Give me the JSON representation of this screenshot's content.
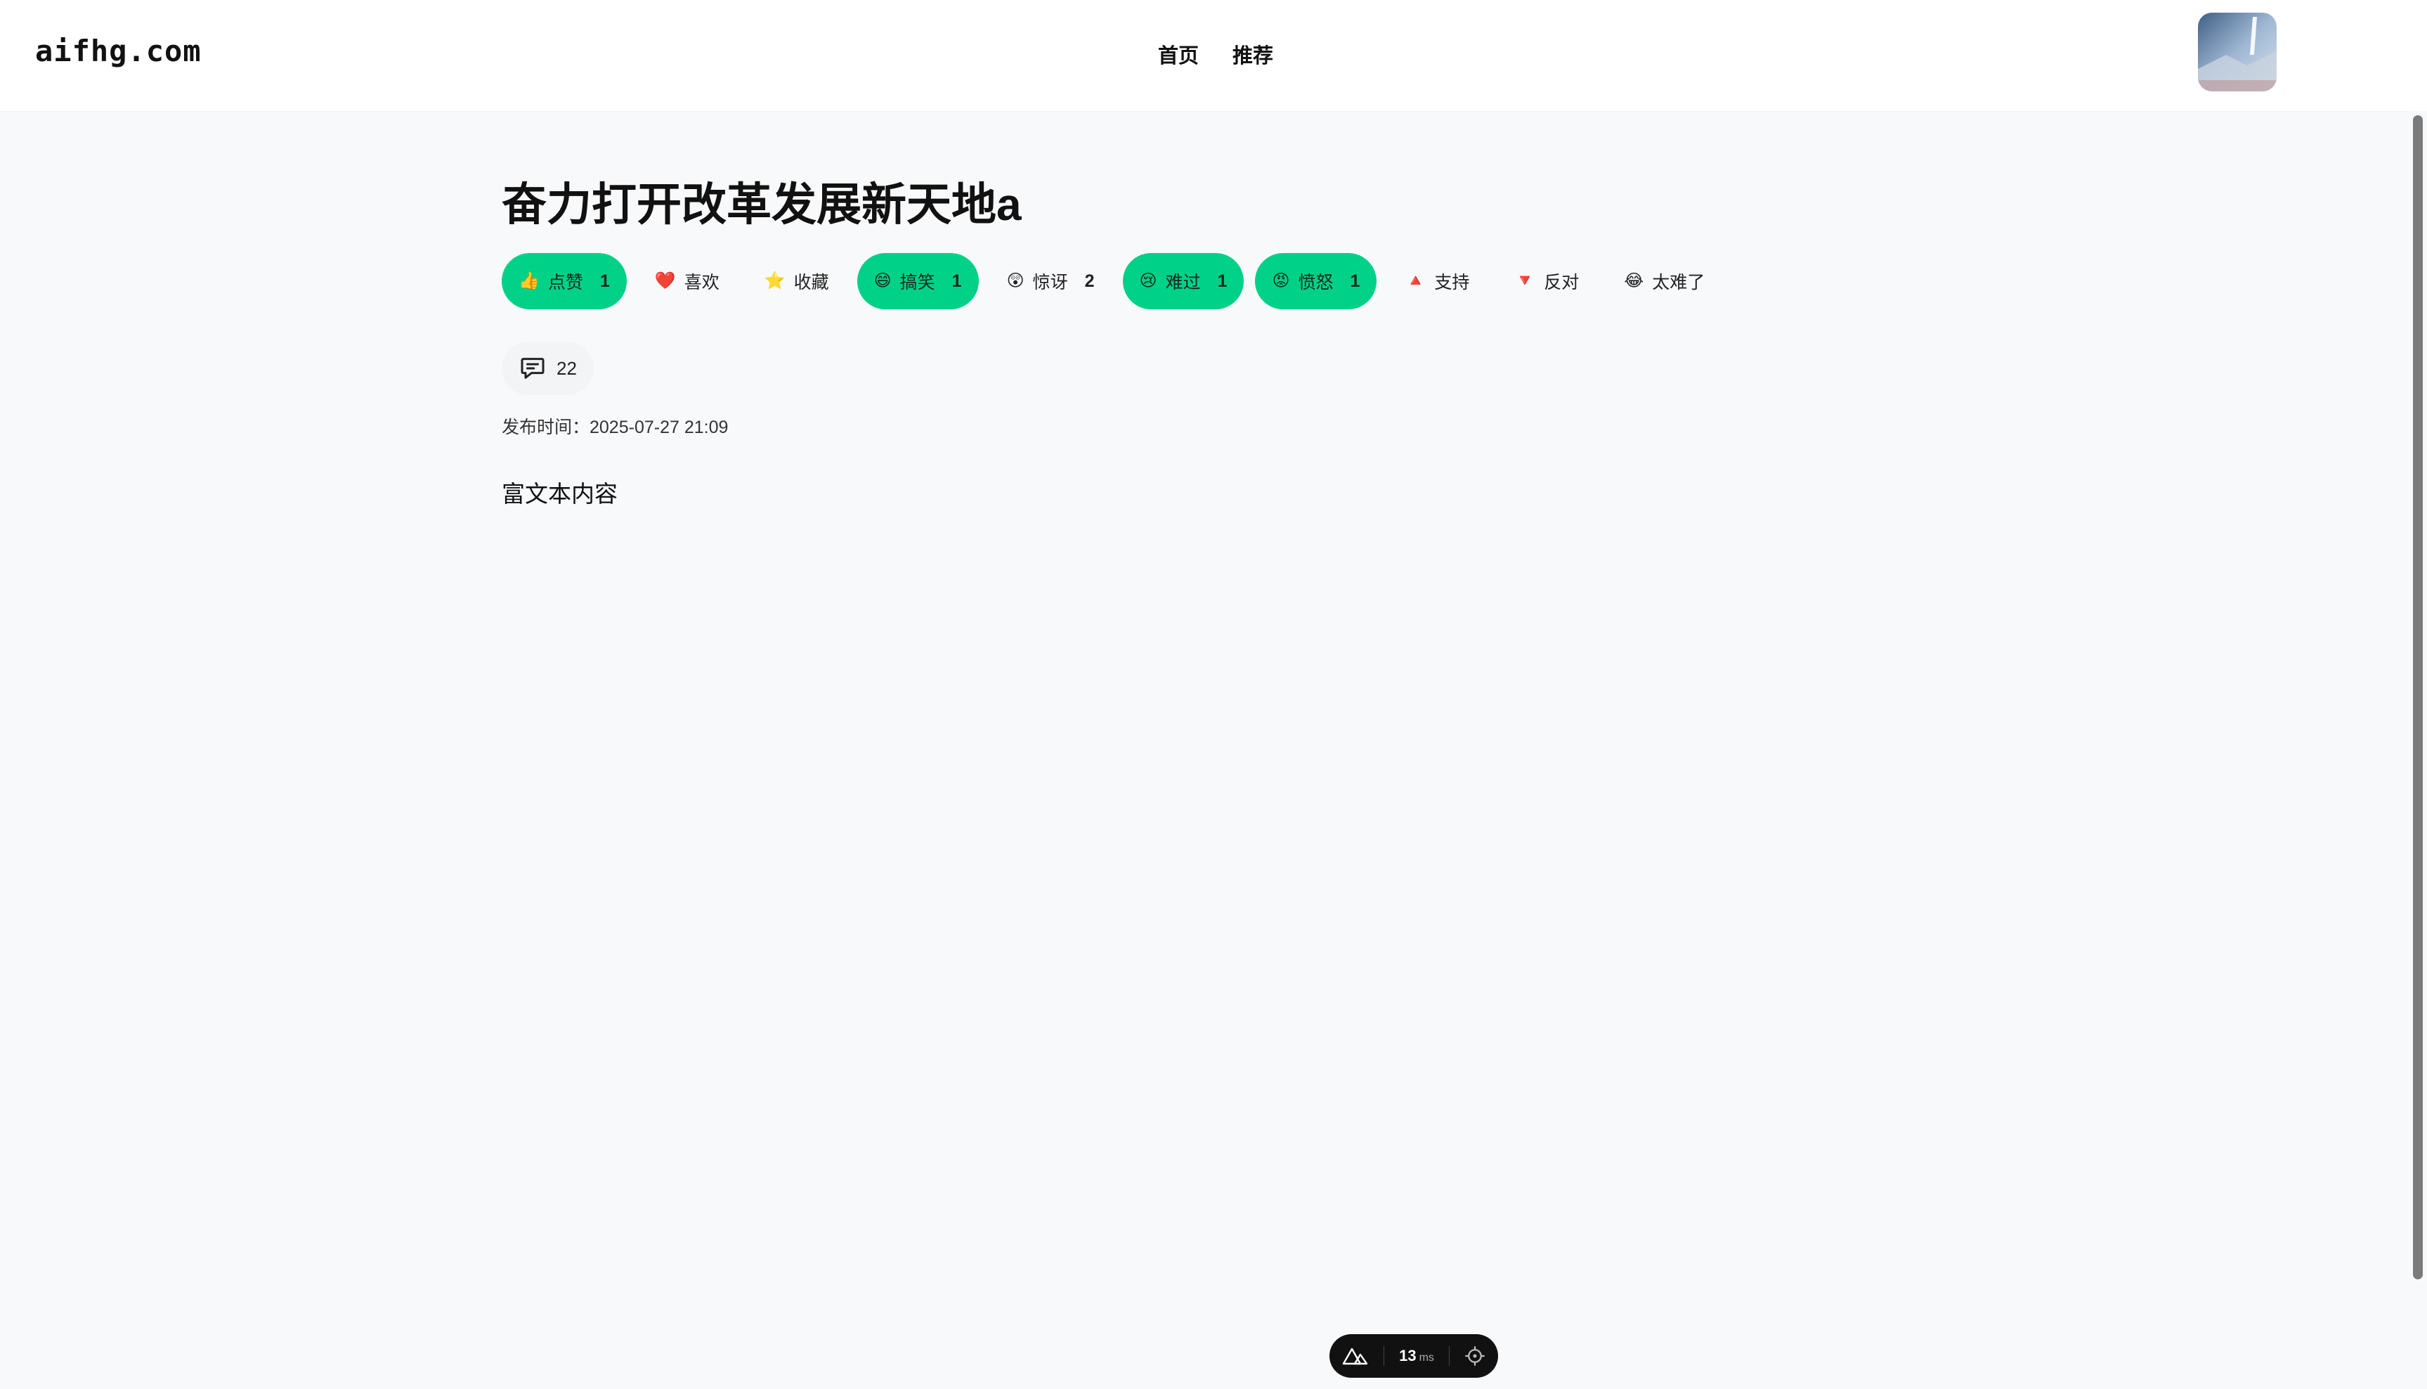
{
  "header": {
    "logo": "aifhg.com",
    "nav": [
      {
        "label": "首页"
      },
      {
        "label": "推荐"
      }
    ]
  },
  "article": {
    "title": "奋力打开改革发展新天地a",
    "reactions": [
      {
        "icon": "thumbs-up",
        "emoji": "👍",
        "label": "点赞",
        "count": "1",
        "active": true
      },
      {
        "icon": "heart",
        "emoji": "❤️",
        "label": "喜欢",
        "count": "",
        "active": false
      },
      {
        "icon": "star",
        "emoji": "⭐",
        "label": "收藏",
        "count": "",
        "active": false
      },
      {
        "icon": "laughing-face",
        "emoji": "😄",
        "label": "搞笑",
        "count": "1",
        "active": true
      },
      {
        "icon": "surprised-face",
        "emoji": "😲",
        "label": "惊讶",
        "count": "2",
        "active": false
      },
      {
        "icon": "sad-face",
        "emoji": "😢",
        "label": "难过",
        "count": "1",
        "active": true
      },
      {
        "icon": "angry-face",
        "emoji": "😡",
        "label": "愤怒",
        "count": "1",
        "active": true
      },
      {
        "icon": "triangle-up",
        "emoji": "🔺",
        "label": "支持",
        "count": "",
        "active": false
      },
      {
        "icon": "triangle-down",
        "emoji": "🔻",
        "label": "反对",
        "count": "",
        "active": false
      },
      {
        "icon": "crying-laughing-face",
        "emoji": "😂",
        "label": "太难了",
        "count": "",
        "active": false
      }
    ],
    "comments_count": "22",
    "published": "发布时间：2025-07-27 21:09",
    "body": "富文本内容"
  },
  "devbar": {
    "time": "13",
    "unit": "ms"
  },
  "colors": {
    "accent": "#00d188",
    "page_bg": "#f8f9fb",
    "header_bg": "#ffffff"
  }
}
